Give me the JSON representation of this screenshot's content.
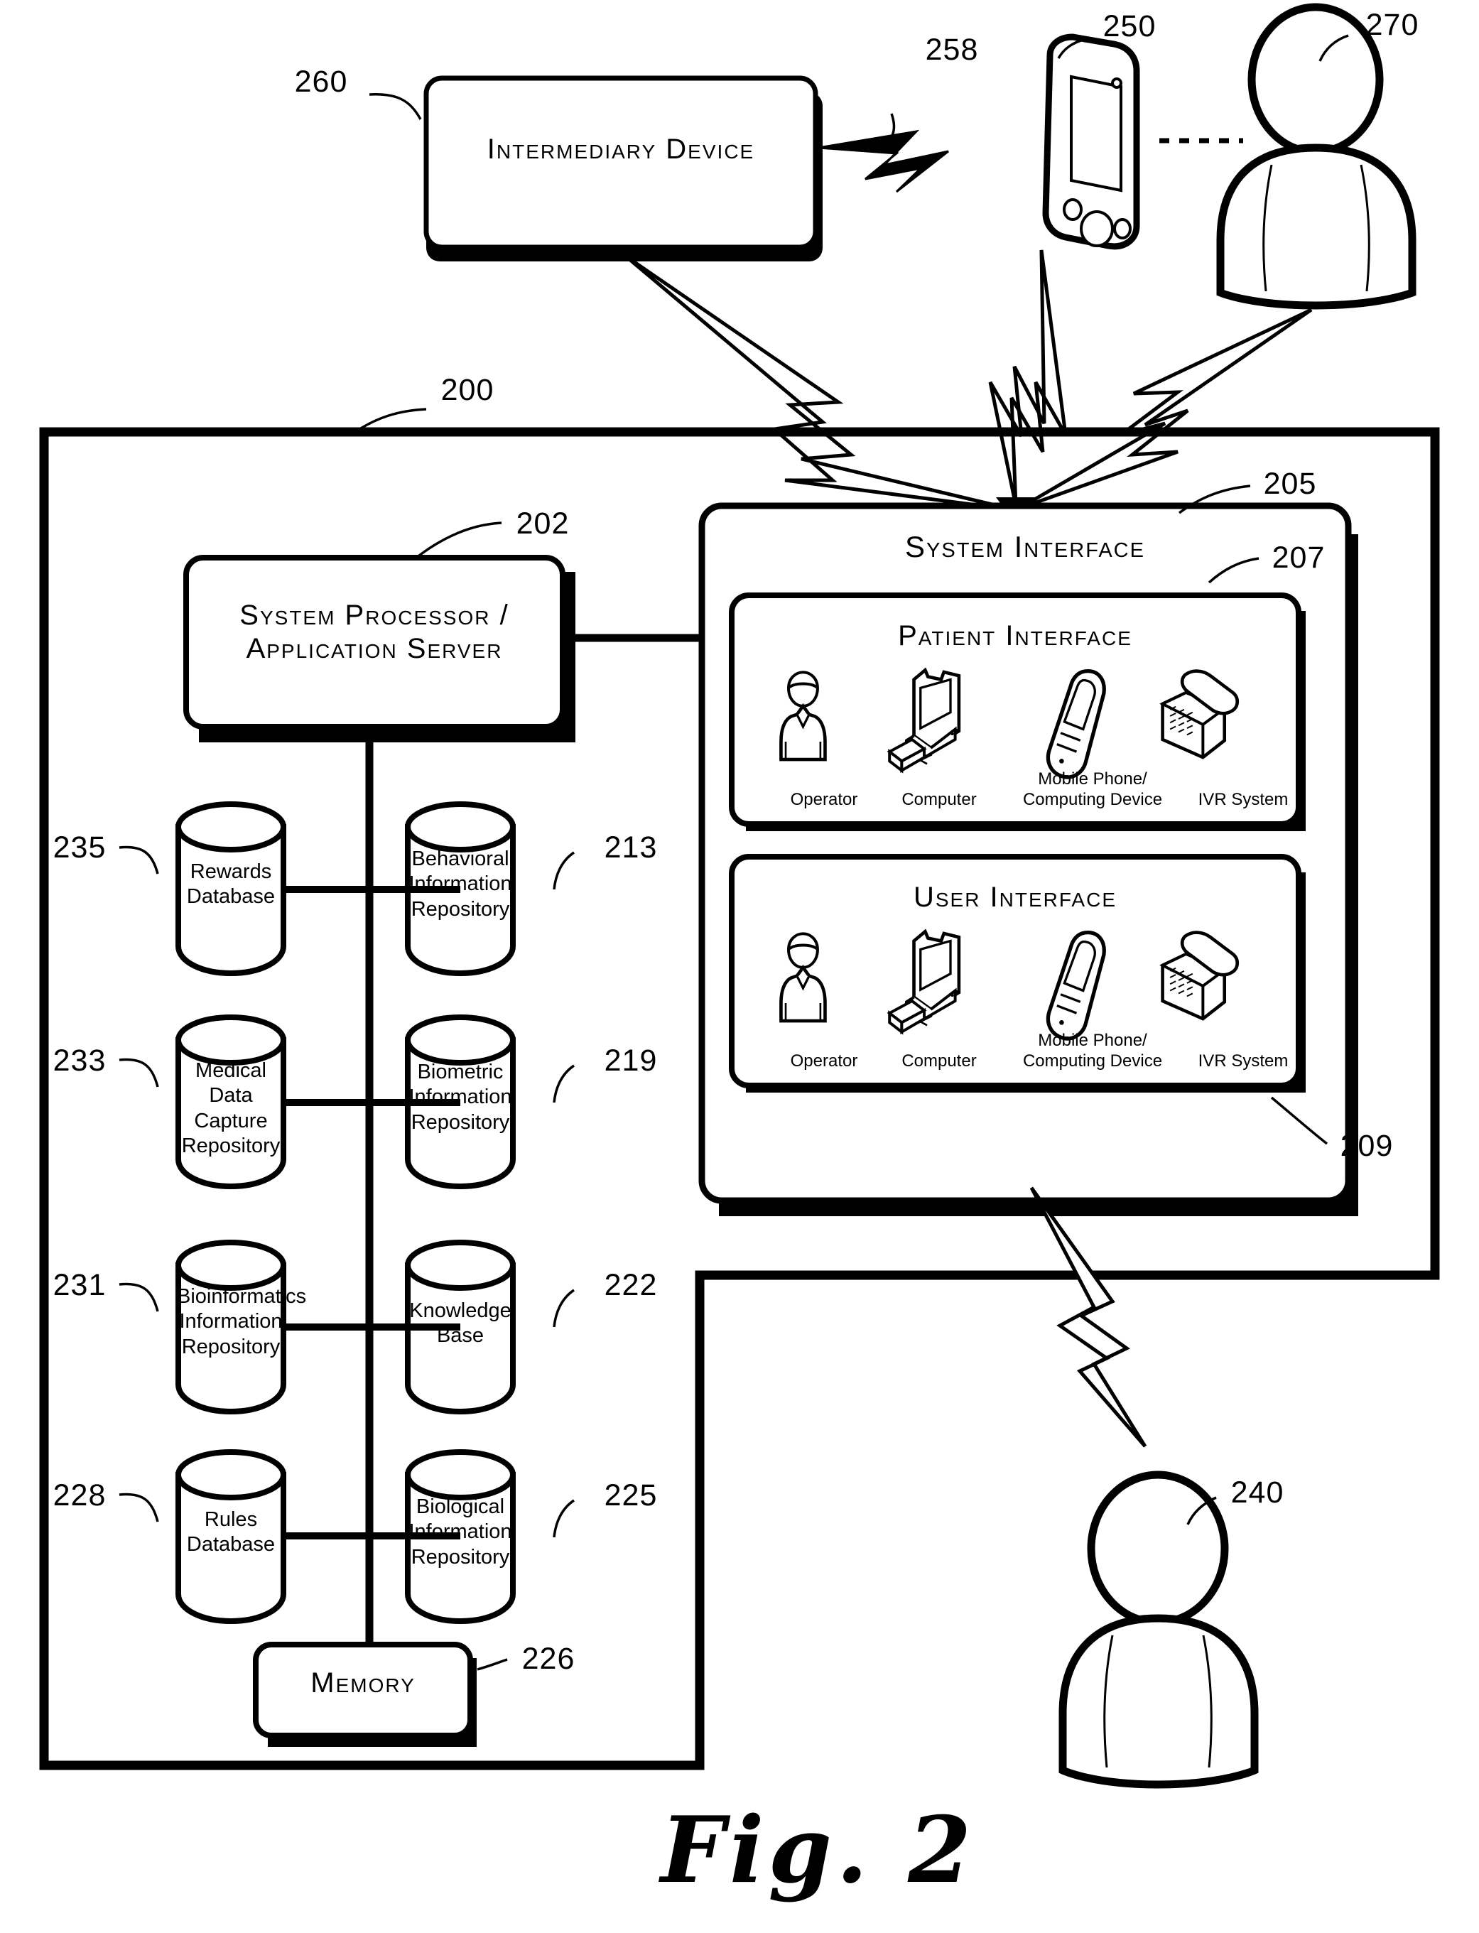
{
  "figure": {
    "caption": "Fig. 2"
  },
  "blocks": {
    "intermediary_device": {
      "label": "Intermediary Device",
      "ref": "260"
    },
    "system_processor": {
      "label": "System Processor /\nApplication Server",
      "ref": "202"
    },
    "memory": {
      "label": "Memory",
      "ref": "226"
    },
    "system_boundary": {
      "ref": "200"
    },
    "system_interface": {
      "label": "System Interface",
      "ref": "205"
    },
    "patient_interface": {
      "label": "Patient Interface",
      "ref": "207"
    },
    "user_interface": {
      "label": "User Interface",
      "ref": "209"
    }
  },
  "actors": {
    "mobile_device": {
      "ref": "250"
    },
    "person_top": {
      "ref": "270"
    },
    "person_bottom": {
      "ref": "240"
    },
    "wireless_link": {
      "ref": "258"
    }
  },
  "databases": [
    {
      "label": "Rewards\nDatabase",
      "ref": "235",
      "ref_side": "left"
    },
    {
      "label": "Behavioral\nInformation\nRepository",
      "ref": "213",
      "ref_side": "right"
    },
    {
      "label": "Medical Data\nCapture\nRepository",
      "ref": "233",
      "ref_side": "left"
    },
    {
      "label": "Biometric\nInformation\nRepository",
      "ref": "219",
      "ref_side": "right"
    },
    {
      "label": "Bioinformatics\nInformation\nRepository",
      "ref": "231",
      "ref_side": "left"
    },
    {
      "label": "Knowledge\nBase",
      "ref": "222",
      "ref_side": "right"
    },
    {
      "label": "Rules\nDatabase",
      "ref": "228",
      "ref_side": "left"
    },
    {
      "label": "Biological\nInformation\nRepository",
      "ref": "225",
      "ref_side": "right"
    }
  ],
  "interface_devices": [
    {
      "icon": "operator-person-icon",
      "label": "Operator"
    },
    {
      "icon": "desktop-computer-icon",
      "label": "Computer"
    },
    {
      "icon": "mobile-phone-icon",
      "label": "Mobile Phone/\nComputing Device"
    },
    {
      "icon": "desk-telephone-icon",
      "label": "IVR System"
    }
  ],
  "colors": {
    "ink": "#000000",
    "paper": "#ffffff"
  }
}
